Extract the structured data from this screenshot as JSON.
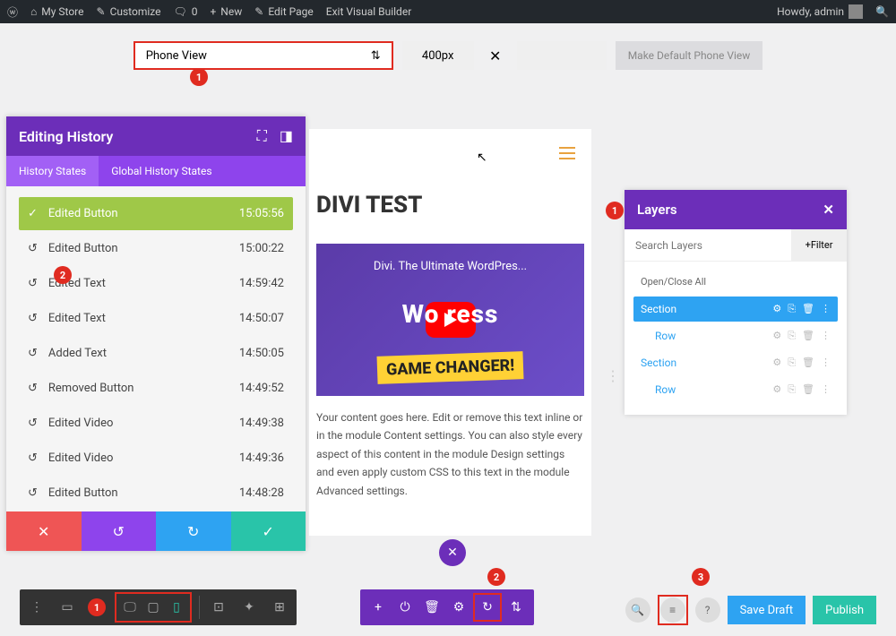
{
  "wpbar": {
    "store": "My Store",
    "customize": "Customize",
    "comments": "0",
    "new": "New",
    "edit": "Edit Page",
    "exit": "Exit Visual Builder",
    "howdy": "Howdy, admin"
  },
  "view": {
    "label": "Phone View",
    "px": "400px",
    "btn": "Make Default Phone View"
  },
  "history": {
    "title": "Editing History",
    "tabs": [
      "History States",
      "Global History States"
    ],
    "items": [
      {
        "label": "Edited Button",
        "time": "15:05:56",
        "current": true,
        "icon": "✓"
      },
      {
        "label": "Edited Button",
        "time": "15:00:22",
        "icon": "↺"
      },
      {
        "label": "Edited Text",
        "time": "14:59:42",
        "icon": "↺"
      },
      {
        "label": "Edited Text",
        "time": "14:50:07",
        "icon": "↺"
      },
      {
        "label": "Added Text",
        "time": "14:50:05",
        "icon": "↺"
      },
      {
        "label": "Removed Button",
        "time": "14:49:52",
        "icon": "↺"
      },
      {
        "label": "Edited Video",
        "time": "14:49:38",
        "icon": "↺"
      },
      {
        "label": "Edited Video",
        "time": "14:49:36",
        "icon": "↺"
      },
      {
        "label": "Edited Button",
        "time": "14:48:28",
        "icon": "↺"
      }
    ]
  },
  "canvas": {
    "title": "DIVI TEST",
    "video_title": "Divi. The Ultimate WordPres...",
    "wp": "Wo    ress",
    "gc": "GAME CHANGER!",
    "desc": "Your content goes here. Edit or remove this text inline or in the module Content settings. You can also style every aspect of this content in the module Design settings and even apply custom CSS to this text in the module Advanced settings."
  },
  "layers": {
    "title": "Layers",
    "placeholder": "Search Layers",
    "filter": "Filter",
    "openall": "Open/Close All",
    "items": [
      {
        "label": "Section",
        "type": "sec"
      },
      {
        "label": "Row",
        "type": "row"
      },
      {
        "label": "Section",
        "type": "secplain"
      },
      {
        "label": "Row",
        "type": "row"
      }
    ]
  },
  "buttons": {
    "draft": "Save Draft",
    "publish": "Publish"
  },
  "badges": {
    "b1": "1",
    "b2": "2",
    "b3": "1",
    "b4": "1",
    "b5": "2",
    "b6": "3"
  }
}
